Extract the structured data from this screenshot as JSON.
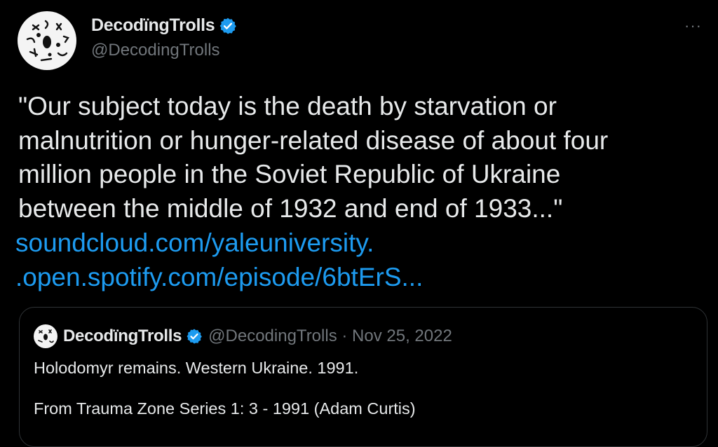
{
  "tweet": {
    "author_name": "DecodïngTrolls",
    "author_handle": "@DecodingTrolls",
    "more_icon": "···",
    "text_lines": [
      "\"Our subject today is the death by starvation or",
      "malnutrition or hunger-related disease of about four",
      "million people in the Soviet Republic of Ukraine",
      "between the middle of 1932 and end of 1933...\""
    ],
    "links": [
      "soundcloud.com/yaleuniversity.",
      ".open.spotify.com/episode/6btErS..."
    ],
    "accent_color": "#1d9bf0"
  },
  "quote": {
    "author_name": "DecodïngTrolls",
    "meta": "@DecodingTrolls · Nov 25, 2022",
    "line1": "Holodomyr remains. Western Ukraine. 1991.",
    "line2": "From Trauma Zone Series 1: 3 - 1991 (Adam Curtis)"
  }
}
